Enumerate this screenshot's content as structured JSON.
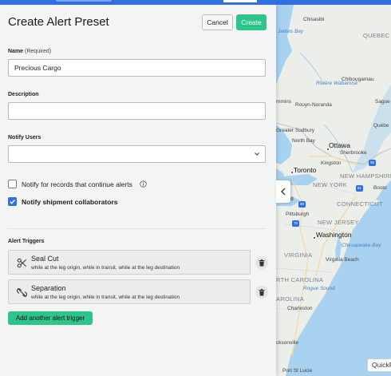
{
  "header": {
    "title": "Create Alert Preset",
    "cancel_label": "Cancel",
    "create_label": "Create"
  },
  "form": {
    "name_label": "Name",
    "name_required": "(Required)",
    "name_value": "Precious Cargo",
    "description_label": "Description",
    "description_value": "",
    "notify_users_label": "Notify Users",
    "notify_users_value": ""
  },
  "options": {
    "continue_alerts_label": "Notify for records that continue alerts",
    "continue_alerts_checked": false,
    "collaborators_label": "Notify shipment collaborators",
    "collaborators_checked": true
  },
  "triggers": {
    "section_label": "Alert Triggers",
    "items": [
      {
        "name": "Seal Cut",
        "description": "while at the leg origin, while in transit, while at the leg destination",
        "icon": "scissors-icon"
      },
      {
        "name": "Separation",
        "description": "while at the leg origin, while in transit, while at the leg destination",
        "icon": "unlink-icon"
      }
    ],
    "add_label": "Add another alert trigger"
  },
  "map": {
    "labels": {
      "chisasibi": "Chisasibi",
      "james_bay": "James\nBay",
      "quebec": "QUEBEC",
      "riviere": "Rivière\nWabamisk",
      "chibougamau": "Chibougamau",
      "timmins": "mmins",
      "rouyn": "Rouyn-Noranda",
      "saguenay": "Sague",
      "greater_sudbury": "Greater Sudbury",
      "ottawa": "Ottawa",
      "north_bay": "North Bay",
      "quebec_city": "Québe",
      "sherbrooke": "Sherbrooke",
      "toronto": "Toronto",
      "kingston": "Kingston",
      "new_hampshire": "NEW HAMPSHIRE",
      "new_york": "NEW YORK",
      "boston": "Bosto",
      "connecticut": "CONNECTICUT",
      "pittsburgh": "Pittsburgh",
      "new_jersey": "NEW JERSEY",
      "washington": "Washington",
      "chesapeake": "Chesapeake\nBay",
      "virginia": "VIRGINIA",
      "virginia_beach": "Virginia Beach",
      "north_carolina": "RTH CAROLINA",
      "pamlico": "Pamlico\nSound",
      "rogue": "Rogue Sound",
      "carolina": "AROLINA",
      "charleston": "Charleston",
      "jacksonville": "cksonville",
      "port_st_lucie": "Port St Lucie",
      "cleveland": "d",
      "hwy_90": "90",
      "hwy_81": "81",
      "hwy_95": "95",
      "hwy_70": "70"
    },
    "quick_label": "QuickF"
  }
}
